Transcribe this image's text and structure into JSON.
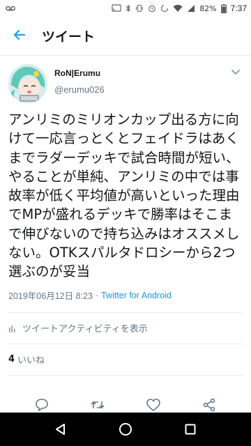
{
  "status_bar": {
    "battery_percent": "82%",
    "time": "7:37"
  },
  "header": {
    "title": "ツイート",
    "back_icon": "arrow-left-icon",
    "accent_color": "#1da1f2"
  },
  "tweet": {
    "display_name": "RoN|Erumu",
    "handle": "@erumu026",
    "text": "アンリミのミリオンカップ出る方に向けて一応言っとくとフェイドラはあくまでラダーデッキで試合時間が短い、やることが単純、アンリミの中では事故率が低く平均値が高いといった理由でMPが盛れるデッキで勝率はそこまで伸びないので持ち込みはオススメしない。OTKスパルタドロシーから2つ選ぶのが妥当",
    "timestamp": "2019年06月12日 8:23",
    "separator": "·",
    "source": "Twitter for Android",
    "source_color": "#1b95e0"
  },
  "activity": {
    "label": "ツイートアクティビティを表示",
    "icon": "bar-chart-icon"
  },
  "likes": {
    "count": "4",
    "label": "いいね"
  },
  "actions": {
    "icons": [
      "reply-icon",
      "retweet-icon",
      "like-icon",
      "share-icon"
    ]
  },
  "nav": {
    "icons": [
      "back-triangle-icon",
      "home-circle-icon",
      "recents-square-icon"
    ]
  }
}
